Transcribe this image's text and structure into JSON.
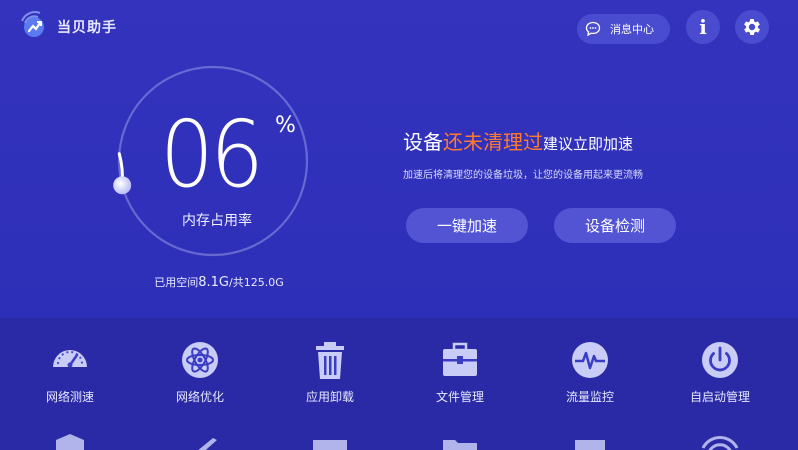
{
  "header": {
    "app_title": "当贝助手",
    "message_center_label": "消息中心",
    "info_icon_label": "i"
  },
  "gauge": {
    "percent": "06",
    "percent_sign": "%",
    "percent_value": 0.06,
    "label": "内存占用率",
    "used_prefix": "已用空间",
    "used_value": "8.1G",
    "total_text": "/共125.0G"
  },
  "status": {
    "headline_pre": "设备",
    "headline_highlight": "还未清理过",
    "headline_post": "建议立即加速",
    "subline": "加速后将清理您的设备垃圾，让您的设备用起来更流畅",
    "accelerate_button": "一键加速",
    "detect_button": "设备检测",
    "highlight_color": "#ff7a2e"
  },
  "tools": [
    {
      "label": "网络测速",
      "icon": "speedometer-icon"
    },
    {
      "label": "网络优化",
      "icon": "atom-icon"
    },
    {
      "label": "应用卸载",
      "icon": "trash-icon"
    },
    {
      "label": "文件管理",
      "icon": "briefcase-icon"
    },
    {
      "label": "流量监控",
      "icon": "pulse-icon"
    },
    {
      "label": "自启动管理",
      "icon": "power-icon"
    }
  ],
  "colors": {
    "background": "#2f2fb7",
    "panel": "#2a2aa6",
    "button": "#5254d4"
  }
}
